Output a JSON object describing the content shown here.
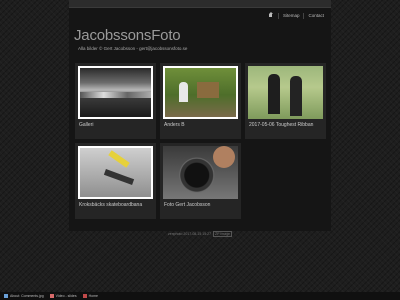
{
  "header": {
    "nav": [
      {
        "label": "",
        "icon": "home-icon"
      },
      {
        "label": "Sitemap"
      },
      {
        "label": "Contact"
      }
    ],
    "site_title": "JacobssonsFoto",
    "subtitle": "Alla bilder © Gert Jacobsson - gert@jacobssonsfoto.se"
  },
  "gallery": [
    {
      "label": "Galleri",
      "thumb": "galleri"
    },
    {
      "label": "Anders B",
      "thumb": "anders"
    },
    {
      "label": "2017-05-06 Toughest Ribban",
      "thumb": "race"
    },
    {
      "label": "Kroksbäcks skateboardbana",
      "thumb": "skate"
    },
    {
      "label": "Foto Gert Jacobsson",
      "thumb": "foto"
    }
  ],
  "footer": {
    "text": "zenphoto 2017-08-15 15:27",
    "badge": "ZP image"
  },
  "taskbar": {
    "items": [
      {
        "label": "About: Comments.jpg",
        "icon": "image-icon"
      },
      {
        "label": "Video - slides",
        "icon": "video-icon"
      },
      {
        "label": "Home",
        "icon": "home-icon"
      }
    ]
  }
}
